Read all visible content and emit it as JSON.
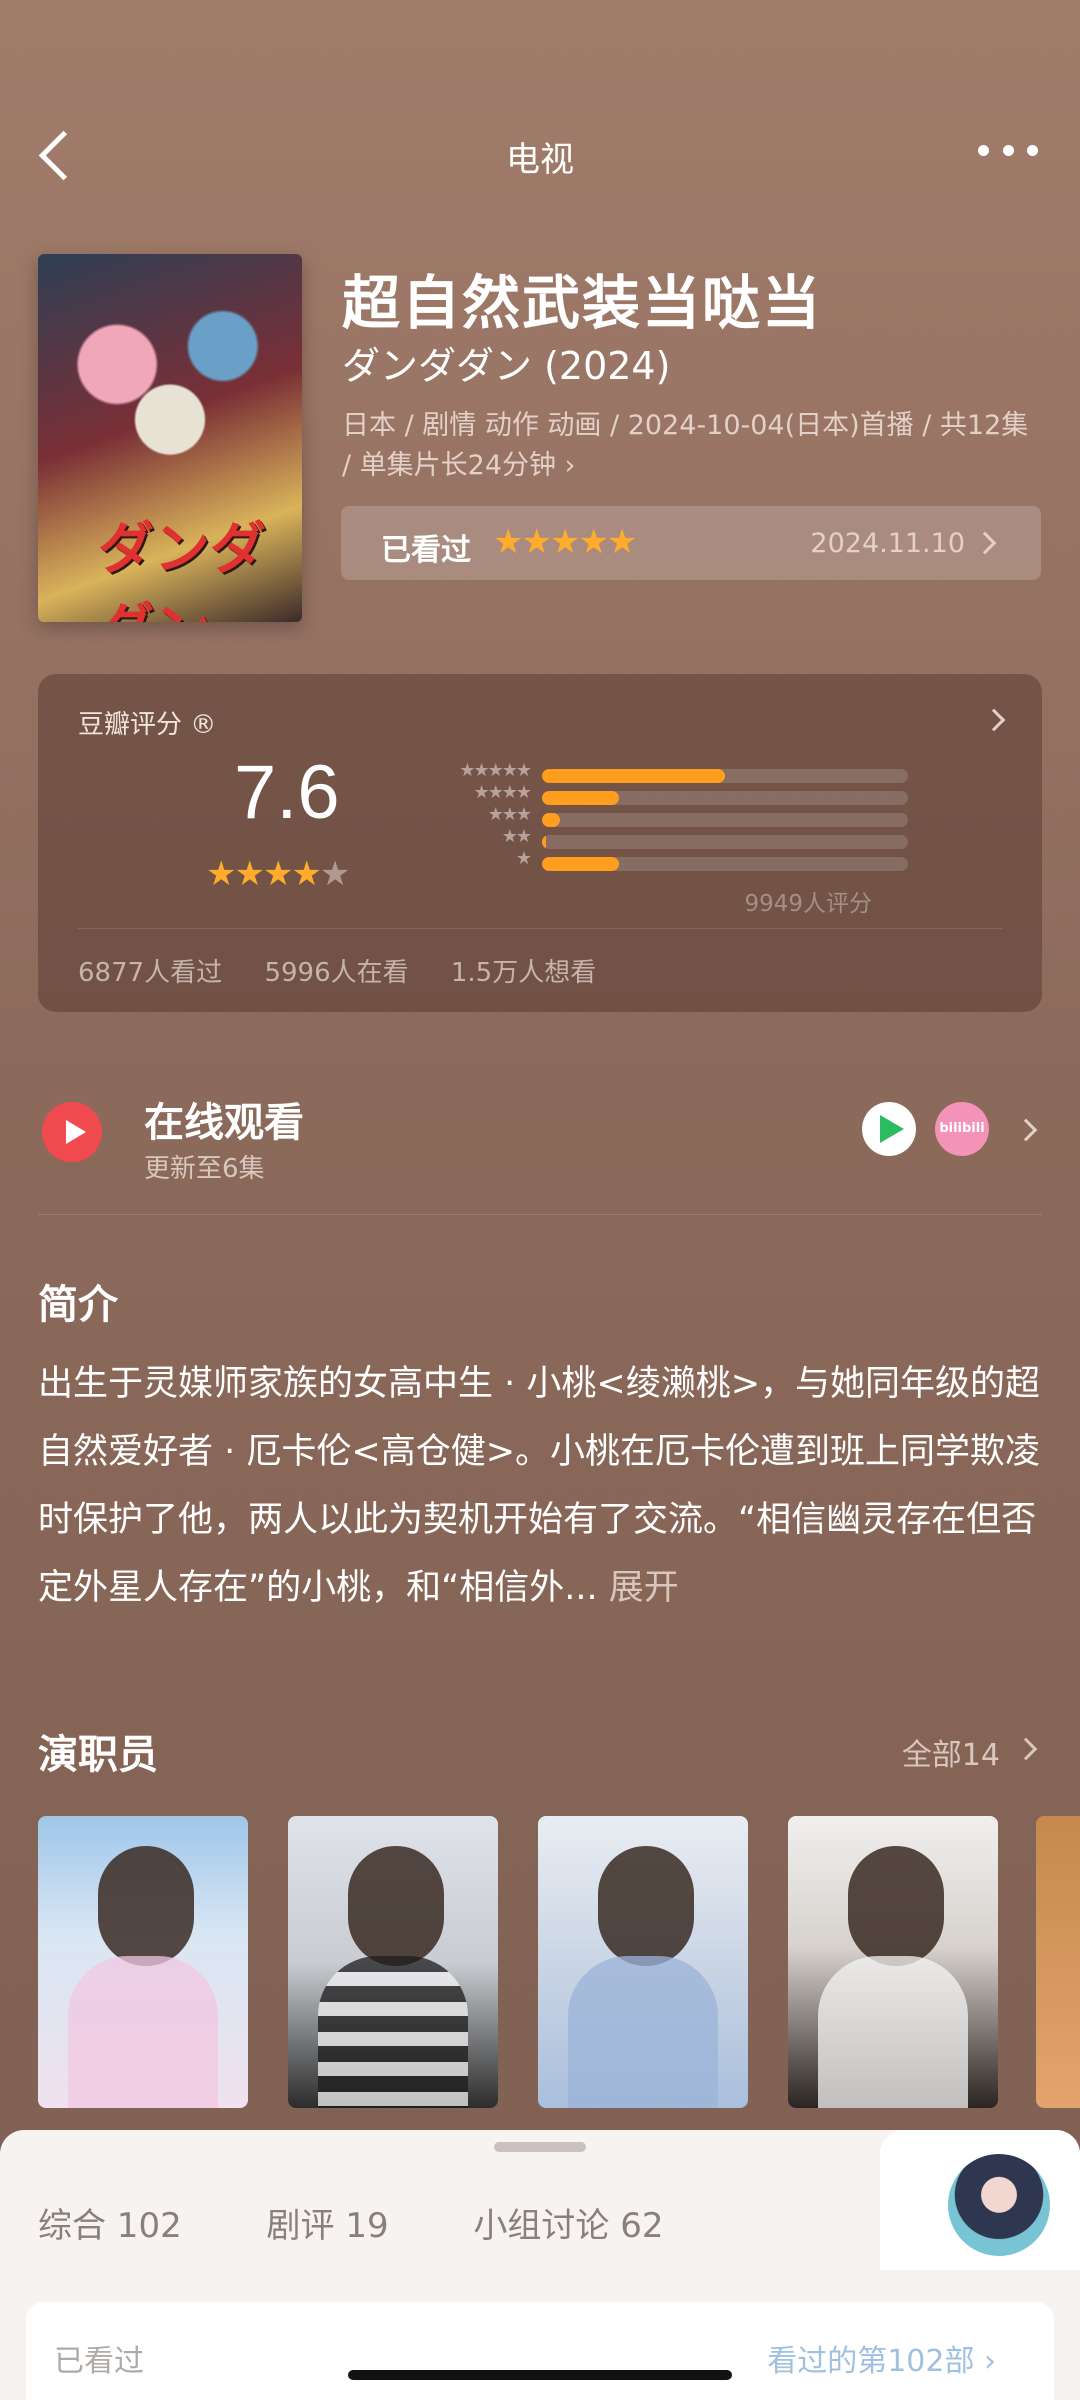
{
  "header": {
    "title": "电视"
  },
  "show": {
    "title": "超自然武装当哒当",
    "original_title": "ダンダダン (2024)",
    "meta": "日本 / 剧情 动作 动画 / 2024-10-04(日本)首播 / 共12集 / 单集片长24分钟 ›",
    "poster_logo": "ダンダダン"
  },
  "watched": {
    "label": "已看过",
    "stars": "★★★★★",
    "date": "2024.11.10"
  },
  "rating": {
    "label": "豆瓣评分 ®",
    "score": "7.6",
    "stars_on": "★★★★",
    "stars_off": "★",
    "distribution": [
      {
        "stars": "★★★★★",
        "fraction": 0.5
      },
      {
        "stars": "★★★★",
        "fraction": 0.21
      },
      {
        "stars": "★★★",
        "fraction": 0.05
      },
      {
        "stars": "★★",
        "fraction": 0.01
      },
      {
        "stars": "★",
        "fraction": 0.21
      }
    ],
    "count": "9949人评分",
    "stats": [
      "6877人看过",
      "5996人在看",
      "1.5万人想看"
    ]
  },
  "watch_online": {
    "title": "在线观看",
    "subtitle": "更新至6集",
    "bili_text": "bilibili"
  },
  "synopsis": {
    "title": "简介",
    "text": "出生于灵媒师家族的女高中生 · 小桃<绫濑桃>，与她同年级的超自然爱好者 · 厄卡伦<高仓健>。小桃在厄卡伦遭到班上同学欺凌时保护了他，两人以此为契机开始有了交流。“相信幽灵存在但否定外星人存在”的小桃，和“相信外...",
    "expand": "展开"
  },
  "cast": {
    "title": "演职员",
    "all": "全部14"
  },
  "sheet": {
    "tabs": [
      "综合 102",
      "剧评 19",
      "小组讨论 62"
    ],
    "card_left": "已看过",
    "card_right": "看过的第102部 ›"
  },
  "colors": {
    "accent": "#ff9d1e",
    "play": "#f14b50",
    "background": "#8c6a5b"
  }
}
